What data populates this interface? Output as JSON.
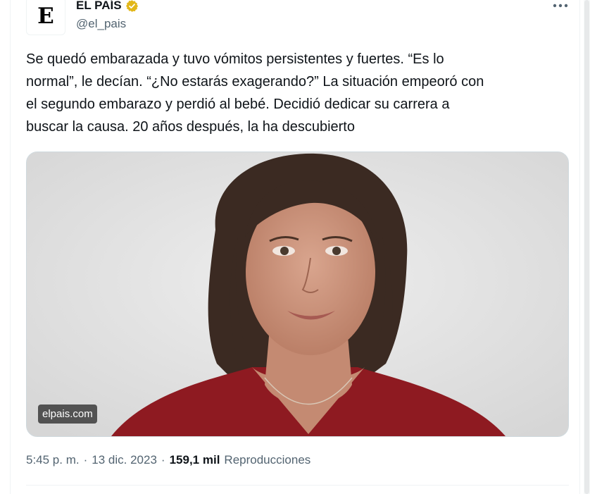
{
  "account": {
    "name": "EL PAÍS",
    "handle": "@el_pais",
    "avatar_letter": "E",
    "verified_color": "#e2b719"
  },
  "tweet": {
    "text": "Se quedó embarazada y tuvo vómitos persistentes y fuertes. “Es lo\nnormal”, le decían. “¿No estarás exagerando?” La situación empeoró con\nel segundo embarazo y perdió al bebé. Decidió dedicar su carrera a\nbuscar la causa. 20 años después, la ha descubierto",
    "media_source": "elpais.com"
  },
  "meta": {
    "time": "5:45 p. m.",
    "separator": "·",
    "date": "13 dic. 2023",
    "views_count": "159,1 mil",
    "views_label": "Reproducciones"
  },
  "colors": {
    "text_primary": "#0f1419",
    "text_secondary": "#536471",
    "border": "#cfd9de"
  },
  "icons": {
    "verified": "verified-badge-icon",
    "more": "more-options-icon"
  }
}
